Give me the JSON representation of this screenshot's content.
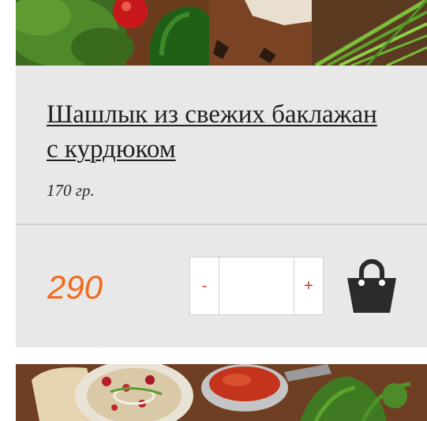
{
  "product": {
    "title": "Шашлык из свежих баклажан с курдюком",
    "weight": "170 гр.",
    "price": "290"
  },
  "stepper": {
    "decrement_label": "-",
    "increment_label": "+",
    "quantity": ""
  },
  "icons": {
    "cart": "shopping-bag-icon"
  },
  "colors": {
    "price": "#f26a1b",
    "stepper_symbol": "#c0392b",
    "card_background": "#e8e8e8",
    "cart_icon": "#2b2b2b"
  }
}
